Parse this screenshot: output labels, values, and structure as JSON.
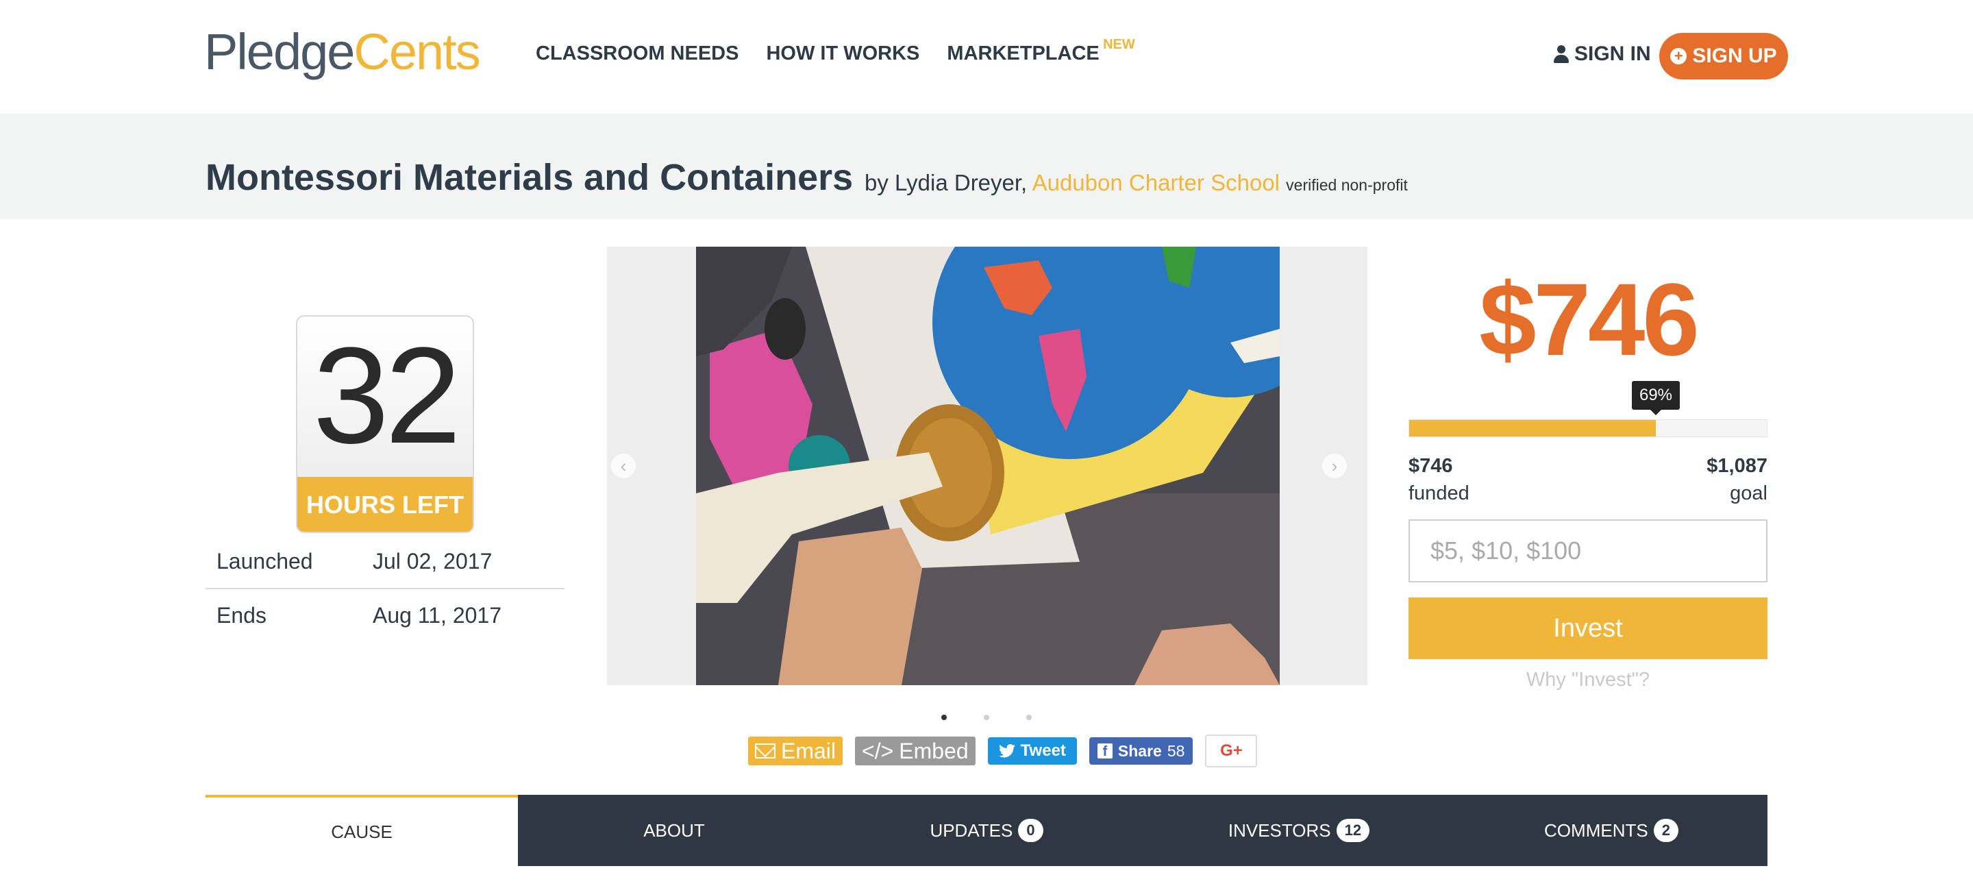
{
  "header": {
    "logo_pledge": "Pledge",
    "logo_cents": "Cents",
    "nav": [
      "CLASSROOM NEEDS",
      "HOW IT WORKS",
      "MARKETPLACE"
    ],
    "nav_new_tag": "NEW",
    "signin_label": "SIGN IN",
    "signup_label": "SIGN UP"
  },
  "project": {
    "title": "Montessori Materials and Containers",
    "by_prefix": "by Lydia Dreyer,",
    "school": "Audubon Charter School",
    "verified": "verified non-profit"
  },
  "countdown": {
    "value": "32",
    "label": "HOURS LEFT"
  },
  "dates": {
    "launched_label": "Launched",
    "launched_value": "Jul 02, 2017",
    "ends_label": "Ends",
    "ends_value": "Aug 11, 2017"
  },
  "carousel": {
    "slide_count": 3,
    "active_index": 0
  },
  "share": {
    "email_label": "Email",
    "embed_label": "Embed",
    "tweet_label": "Tweet",
    "fb_label": "Share",
    "fb_count": "58",
    "gplus_label": "G+"
  },
  "funding": {
    "amount": "$746",
    "percent_label": "69%",
    "progress_fraction": 0.69,
    "funded_value": "$746",
    "funded_label": "funded",
    "goal_value": "$1,087",
    "goal_label": "goal",
    "input_placeholder": "$5, $10, $100",
    "invest_label": "Invest",
    "why_label": "Why \"Invest\"?"
  },
  "tabs": [
    {
      "label": "CAUSE",
      "badge": null
    },
    {
      "label": "ABOUT",
      "badge": null
    },
    {
      "label": "UPDATES",
      "badge": "0"
    },
    {
      "label": "INVESTORS",
      "badge": "12"
    },
    {
      "label": "COMMENTS",
      "badge": "2"
    }
  ],
  "colors": {
    "accent_orange": "#e46e2a",
    "accent_yellow": "#f0b63a",
    "dark_nav": "#2f3742"
  }
}
